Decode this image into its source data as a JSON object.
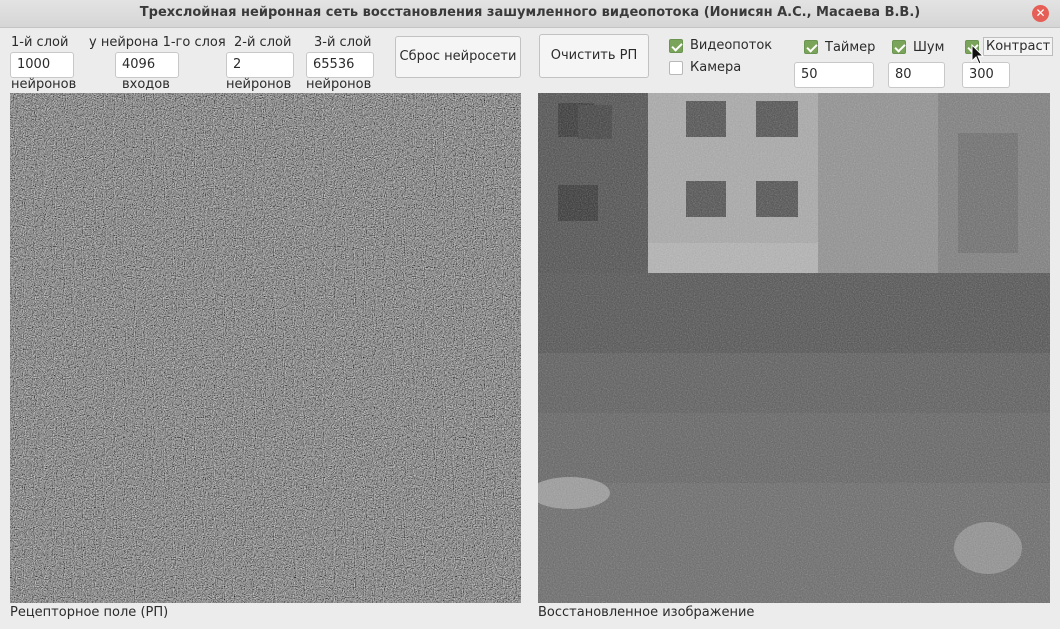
{
  "window": {
    "title": "Трехслойная нейронная сеть восстановления зашумленного видеопотока (Ионисян А.С., Масаева В.В.)"
  },
  "layer1": {
    "label": "1-й слой",
    "value": "1000",
    "sublabel": "нейронов"
  },
  "inputs_per_neuron": {
    "label": "у нейрона 1-го слоя",
    "value": "4096",
    "sublabel": "входов"
  },
  "layer2": {
    "label": "2-й слой",
    "value": "2",
    "sublabel": "нейронов"
  },
  "layer3": {
    "label": "3-й слой",
    "value": "65536",
    "sublabel": "нейронов"
  },
  "buttons": {
    "reset": "Сброс нейросети",
    "clear": "Очистить РП"
  },
  "checkboxes": {
    "video": {
      "label": "Видеопоток",
      "checked": true
    },
    "camera": {
      "label": "Камера",
      "checked": false
    },
    "timer": {
      "label": "Таймер",
      "checked": true,
      "value": "50"
    },
    "noise": {
      "label": "Шум",
      "checked": true,
      "value": "80"
    },
    "contrast": {
      "label": "Контраст",
      "checked": true,
      "value": "300"
    }
  },
  "panels": {
    "receptor_caption": "Рецепторное поле (РП)",
    "restored_caption": "Восстановленное изображение"
  },
  "colors": {
    "accent_check": "#7aa45a",
    "close_button": "#e65f56"
  }
}
